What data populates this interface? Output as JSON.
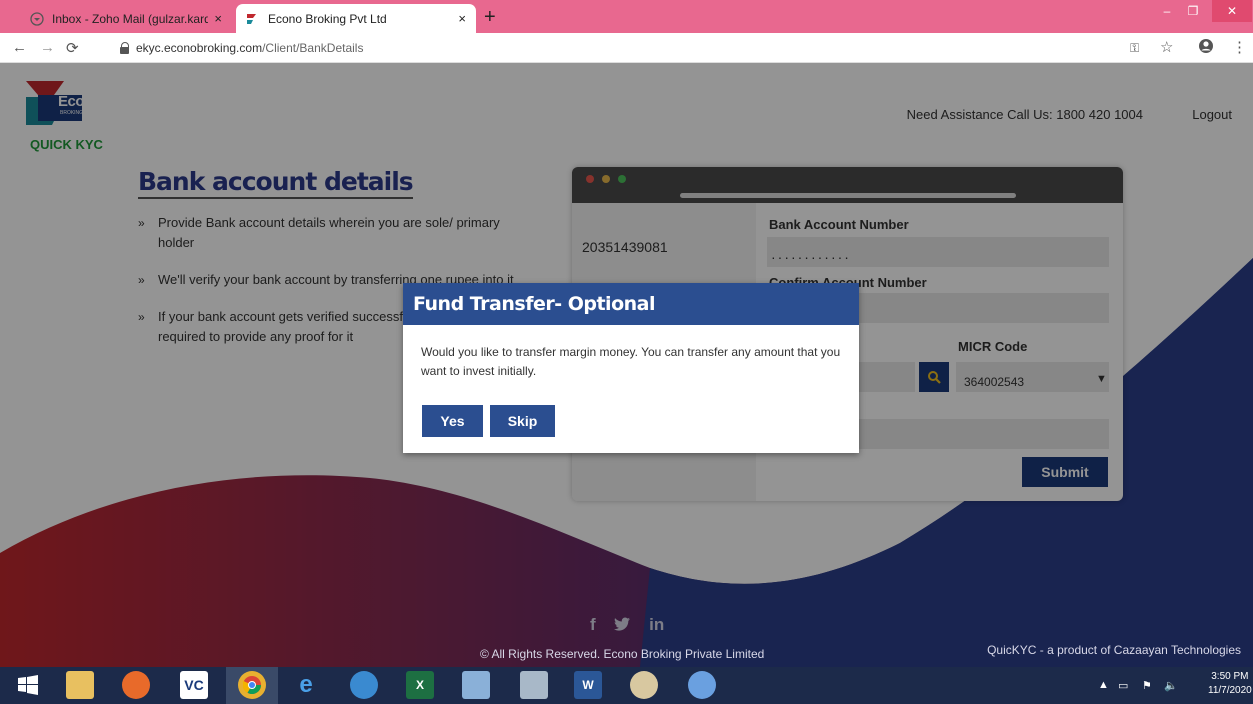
{
  "browser": {
    "tabs": [
      {
        "title": "Inbox - Zoho Mail (gulzar.kardom",
        "active": false
      },
      {
        "title": "Econo Broking Pvt Ltd",
        "active": true
      }
    ],
    "new_tab": "+",
    "close_glyph": "×",
    "url_host": "ekyc.econobroking.com",
    "url_path": "/Client/BankDetails",
    "window_controls": {
      "minimize": "–",
      "maximize": "❐",
      "close": "✕"
    }
  },
  "header": {
    "logo_brand": "Econo",
    "logo_sub": "BROKING PVT LTD",
    "logo_tagline": "QUICK KYC",
    "assistance": "Need Assistance Call Us: 1800 420 1004",
    "logout": "Logout"
  },
  "main": {
    "title": "Bank account details",
    "bullets": [
      "Provide Bank account details wherein you are sole/ primary holder",
      "We'll verify your bank account by transferring one rupee into it",
      "If your bank account gets verified successfully, you will not be required to provide any proof for it"
    ]
  },
  "form": {
    "account_number_partial": "20351439081",
    "bank_account_label": "Bank Account Number",
    "bank_account_value": "············",
    "confirm_label": "Confirm Account Number",
    "micr_label": "MICR Code",
    "micr_value": "364002543",
    "submit_label": "Submit"
  },
  "modal": {
    "title": "Fund Transfer- Optional",
    "message": "Would you like to transfer margin money. You can transfer any amount that you want to invest initially.",
    "yes_label": "Yes",
    "skip_label": "Skip"
  },
  "footer": {
    "social": [
      "f",
      "🐦",
      "in"
    ],
    "copyright": "© All Rights Reserved. Econo Broking Private Limited",
    "product": "QuicKYC - a product of Cazaayan Technologies"
  },
  "taskbar": {
    "time": "3:50 PM",
    "date": "11/7/2020"
  },
  "colors": {
    "tabbar": "#e8688f",
    "primary_blue": "#2b4e90",
    "navy": "#1a3a7a",
    "wave_red": "#c0282e"
  }
}
